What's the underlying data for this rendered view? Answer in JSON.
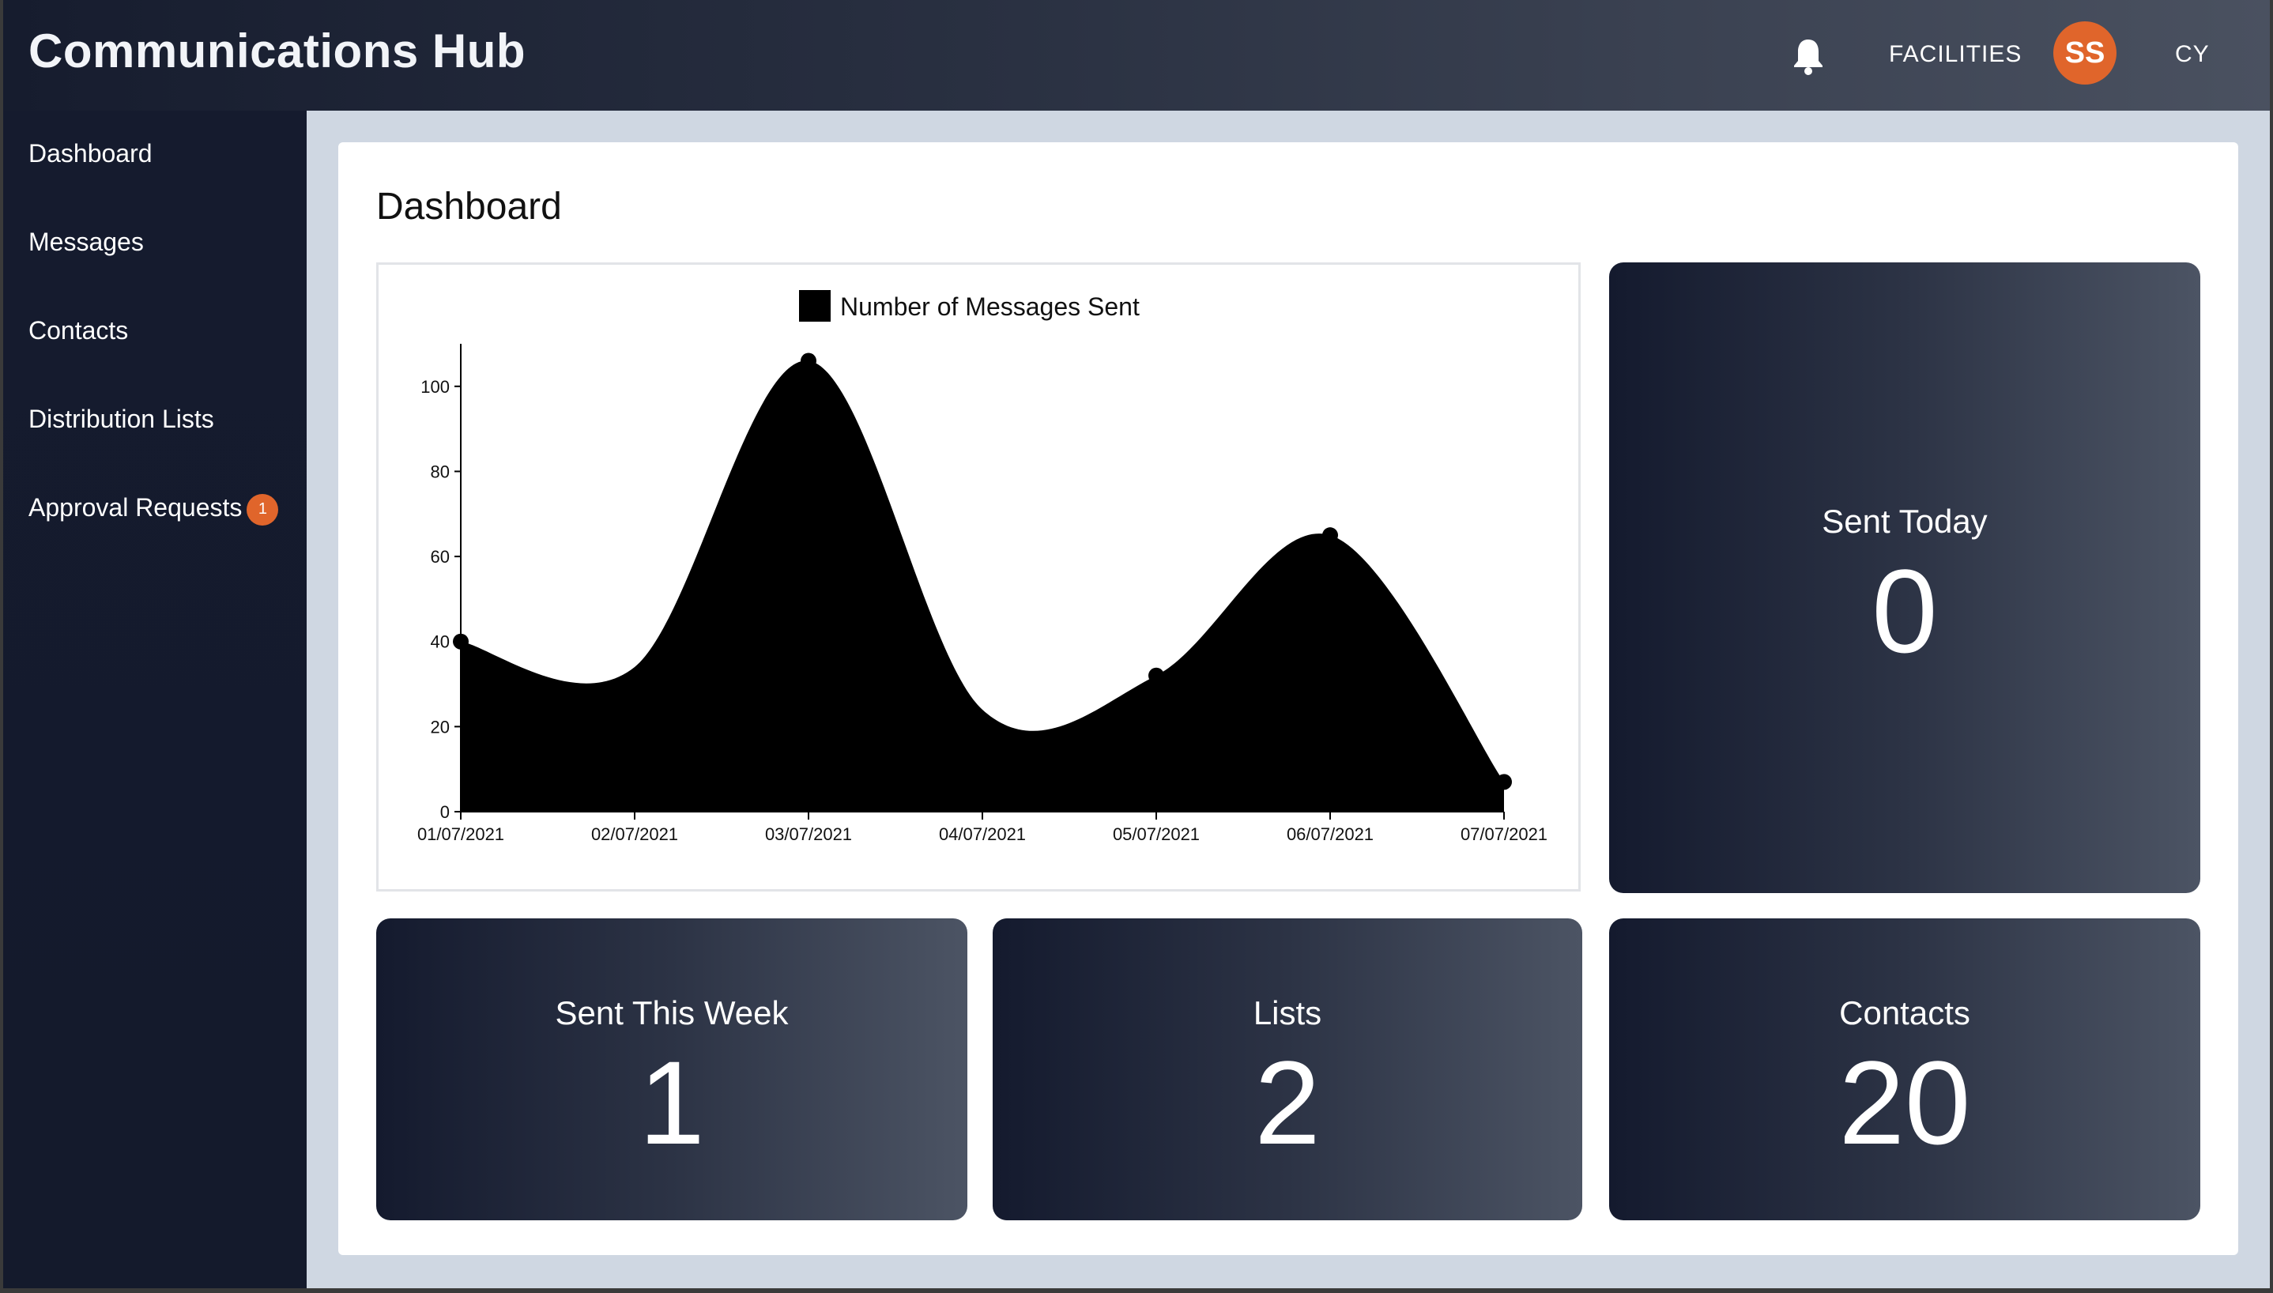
{
  "header": {
    "title": "Communications Hub",
    "facilities_label": "FACILITIES",
    "avatar_initials": "SS",
    "language": "CY",
    "accent_color": "#e0652b"
  },
  "sidebar": {
    "items": [
      {
        "label": "Dashboard"
      },
      {
        "label": "Messages"
      },
      {
        "label": "Contacts"
      },
      {
        "label": "Distribution Lists"
      },
      {
        "label": "Approval Requests",
        "badge": "1"
      }
    ]
  },
  "main": {
    "title": "Dashboard",
    "tiles": {
      "sent_today": {
        "label": "Sent Today",
        "value": "0"
      },
      "sent_week": {
        "label": "Sent This Week",
        "value": "1"
      },
      "lists": {
        "label": "Lists",
        "value": "2"
      },
      "contacts": {
        "label": "Contacts",
        "value": "20"
      }
    }
  },
  "chart_data": {
    "type": "area",
    "legend": "Number of Messages Sent",
    "categories": [
      "01/07/2021",
      "02/07/2021",
      "03/07/2021",
      "04/07/2021",
      "05/07/2021",
      "06/07/2021",
      "07/07/2021"
    ],
    "values": [
      40,
      34,
      106,
      24,
      32,
      65,
      7
    ],
    "point_marker_days": [
      0,
      2,
      4,
      5,
      6
    ],
    "y_ticks": [
      0,
      20,
      40,
      60,
      80,
      100
    ],
    "ylim": [
      0,
      110
    ],
    "fill_color": "#000000"
  }
}
